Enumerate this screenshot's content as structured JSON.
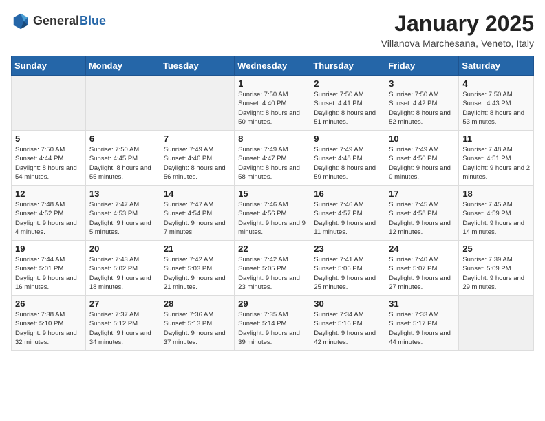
{
  "header": {
    "logo_general": "General",
    "logo_blue": "Blue",
    "month": "January 2025",
    "location": "Villanova Marchesana, Veneto, Italy"
  },
  "days_of_week": [
    "Sunday",
    "Monday",
    "Tuesday",
    "Wednesday",
    "Thursday",
    "Friday",
    "Saturday"
  ],
  "weeks": [
    [
      {
        "day": "",
        "sunrise": "",
        "sunset": "",
        "daylight": ""
      },
      {
        "day": "",
        "sunrise": "",
        "sunset": "",
        "daylight": ""
      },
      {
        "day": "",
        "sunrise": "",
        "sunset": "",
        "daylight": ""
      },
      {
        "day": "1",
        "sunrise": "Sunrise: 7:50 AM",
        "sunset": "Sunset: 4:40 PM",
        "daylight": "Daylight: 8 hours and 50 minutes."
      },
      {
        "day": "2",
        "sunrise": "Sunrise: 7:50 AM",
        "sunset": "Sunset: 4:41 PM",
        "daylight": "Daylight: 8 hours and 51 minutes."
      },
      {
        "day": "3",
        "sunrise": "Sunrise: 7:50 AM",
        "sunset": "Sunset: 4:42 PM",
        "daylight": "Daylight: 8 hours and 52 minutes."
      },
      {
        "day": "4",
        "sunrise": "Sunrise: 7:50 AM",
        "sunset": "Sunset: 4:43 PM",
        "daylight": "Daylight: 8 hours and 53 minutes."
      }
    ],
    [
      {
        "day": "5",
        "sunrise": "Sunrise: 7:50 AM",
        "sunset": "Sunset: 4:44 PM",
        "daylight": "Daylight: 8 hours and 54 minutes."
      },
      {
        "day": "6",
        "sunrise": "Sunrise: 7:50 AM",
        "sunset": "Sunset: 4:45 PM",
        "daylight": "Daylight: 8 hours and 55 minutes."
      },
      {
        "day": "7",
        "sunrise": "Sunrise: 7:49 AM",
        "sunset": "Sunset: 4:46 PM",
        "daylight": "Daylight: 8 hours and 56 minutes."
      },
      {
        "day": "8",
        "sunrise": "Sunrise: 7:49 AM",
        "sunset": "Sunset: 4:47 PM",
        "daylight": "Daylight: 8 hours and 58 minutes."
      },
      {
        "day": "9",
        "sunrise": "Sunrise: 7:49 AM",
        "sunset": "Sunset: 4:48 PM",
        "daylight": "Daylight: 8 hours and 59 minutes."
      },
      {
        "day": "10",
        "sunrise": "Sunrise: 7:49 AM",
        "sunset": "Sunset: 4:50 PM",
        "daylight": "Daylight: 9 hours and 0 minutes."
      },
      {
        "day": "11",
        "sunrise": "Sunrise: 7:48 AM",
        "sunset": "Sunset: 4:51 PM",
        "daylight": "Daylight: 9 hours and 2 minutes."
      }
    ],
    [
      {
        "day": "12",
        "sunrise": "Sunrise: 7:48 AM",
        "sunset": "Sunset: 4:52 PM",
        "daylight": "Daylight: 9 hours and 4 minutes."
      },
      {
        "day": "13",
        "sunrise": "Sunrise: 7:47 AM",
        "sunset": "Sunset: 4:53 PM",
        "daylight": "Daylight: 9 hours and 5 minutes."
      },
      {
        "day": "14",
        "sunrise": "Sunrise: 7:47 AM",
        "sunset": "Sunset: 4:54 PM",
        "daylight": "Daylight: 9 hours and 7 minutes."
      },
      {
        "day": "15",
        "sunrise": "Sunrise: 7:46 AM",
        "sunset": "Sunset: 4:56 PM",
        "daylight": "Daylight: 9 hours and 9 minutes."
      },
      {
        "day": "16",
        "sunrise": "Sunrise: 7:46 AM",
        "sunset": "Sunset: 4:57 PM",
        "daylight": "Daylight: 9 hours and 11 minutes."
      },
      {
        "day": "17",
        "sunrise": "Sunrise: 7:45 AM",
        "sunset": "Sunset: 4:58 PM",
        "daylight": "Daylight: 9 hours and 12 minutes."
      },
      {
        "day": "18",
        "sunrise": "Sunrise: 7:45 AM",
        "sunset": "Sunset: 4:59 PM",
        "daylight": "Daylight: 9 hours and 14 minutes."
      }
    ],
    [
      {
        "day": "19",
        "sunrise": "Sunrise: 7:44 AM",
        "sunset": "Sunset: 5:01 PM",
        "daylight": "Daylight: 9 hours and 16 minutes."
      },
      {
        "day": "20",
        "sunrise": "Sunrise: 7:43 AM",
        "sunset": "Sunset: 5:02 PM",
        "daylight": "Daylight: 9 hours and 18 minutes."
      },
      {
        "day": "21",
        "sunrise": "Sunrise: 7:42 AM",
        "sunset": "Sunset: 5:03 PM",
        "daylight": "Daylight: 9 hours and 21 minutes."
      },
      {
        "day": "22",
        "sunrise": "Sunrise: 7:42 AM",
        "sunset": "Sunset: 5:05 PM",
        "daylight": "Daylight: 9 hours and 23 minutes."
      },
      {
        "day": "23",
        "sunrise": "Sunrise: 7:41 AM",
        "sunset": "Sunset: 5:06 PM",
        "daylight": "Daylight: 9 hours and 25 minutes."
      },
      {
        "day": "24",
        "sunrise": "Sunrise: 7:40 AM",
        "sunset": "Sunset: 5:07 PM",
        "daylight": "Daylight: 9 hours and 27 minutes."
      },
      {
        "day": "25",
        "sunrise": "Sunrise: 7:39 AM",
        "sunset": "Sunset: 5:09 PM",
        "daylight": "Daylight: 9 hours and 29 minutes."
      }
    ],
    [
      {
        "day": "26",
        "sunrise": "Sunrise: 7:38 AM",
        "sunset": "Sunset: 5:10 PM",
        "daylight": "Daylight: 9 hours and 32 minutes."
      },
      {
        "day": "27",
        "sunrise": "Sunrise: 7:37 AM",
        "sunset": "Sunset: 5:12 PM",
        "daylight": "Daylight: 9 hours and 34 minutes."
      },
      {
        "day": "28",
        "sunrise": "Sunrise: 7:36 AM",
        "sunset": "Sunset: 5:13 PM",
        "daylight": "Daylight: 9 hours and 37 minutes."
      },
      {
        "day": "29",
        "sunrise": "Sunrise: 7:35 AM",
        "sunset": "Sunset: 5:14 PM",
        "daylight": "Daylight: 9 hours and 39 minutes."
      },
      {
        "day": "30",
        "sunrise": "Sunrise: 7:34 AM",
        "sunset": "Sunset: 5:16 PM",
        "daylight": "Daylight: 9 hours and 42 minutes."
      },
      {
        "day": "31",
        "sunrise": "Sunrise: 7:33 AM",
        "sunset": "Sunset: 5:17 PM",
        "daylight": "Daylight: 9 hours and 44 minutes."
      },
      {
        "day": "",
        "sunrise": "",
        "sunset": "",
        "daylight": ""
      }
    ]
  ]
}
